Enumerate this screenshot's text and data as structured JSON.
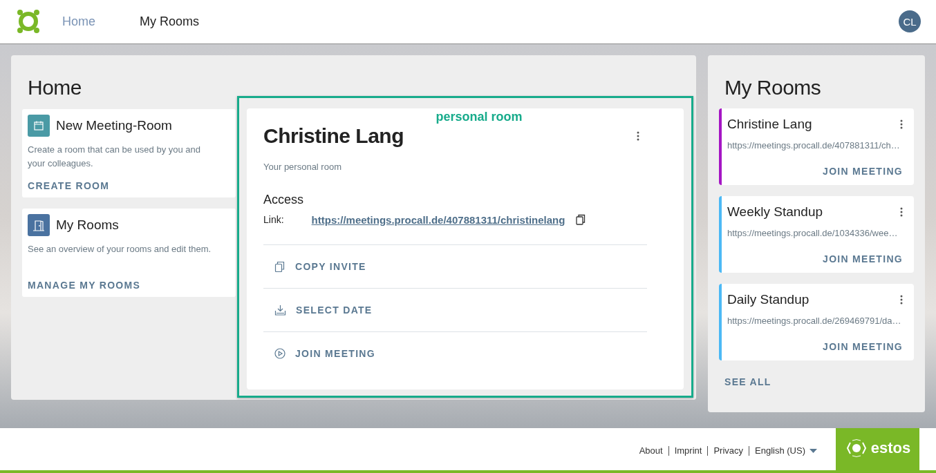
{
  "nav": {
    "items": [
      {
        "label": "Home",
        "selected": true
      },
      {
        "label": "My Rooms",
        "selected": false
      }
    ],
    "avatar": "CL"
  },
  "home": {
    "title": "Home",
    "cards": [
      {
        "kind": "calendar",
        "title": "New Meeting-Room",
        "description": "Create a room that can be used by you and your colleagues.",
        "action": "CREATE ROOM"
      },
      {
        "kind": "door",
        "title": "My Rooms",
        "description": "See an overview of your rooms and edit them.",
        "action": "MANAGE MY ROOMS"
      }
    ],
    "personal_room": {
      "annotation": "personal room",
      "title": "Christine Lang",
      "subtitle": "Your personal room",
      "access_heading": "Access",
      "link_label": "Link:",
      "link": "https://meetings.procall.de/407881311/christinelang",
      "actions": [
        {
          "kind": "copy",
          "label": "COPY INVITE"
        },
        {
          "kind": "date",
          "label": "SELECT DATE"
        },
        {
          "kind": "join",
          "label": "JOIN MEETING"
        }
      ]
    }
  },
  "my_rooms": {
    "title": "My Rooms",
    "rooms": [
      {
        "name": "Christine Lang",
        "url": "https://meetings.procall.de/407881311/ch…",
        "action": "JOIN MEETING",
        "color": "#a516c4"
      },
      {
        "name": "Weekly Standup",
        "url": "https://meetings.procall.de/1034336/wee…",
        "action": "JOIN MEETING",
        "color": "#4cb9f5"
      },
      {
        "name": "Daily Standup",
        "url": "https://meetings.procall.de/269469791/da…",
        "action": "JOIN MEETING",
        "color": "#4cb9f5"
      }
    ],
    "see_all": "SEE ALL"
  },
  "footer": {
    "links": [
      "About",
      "Imprint",
      "Privacy"
    ],
    "language": "English (US)",
    "brand": "estos"
  }
}
